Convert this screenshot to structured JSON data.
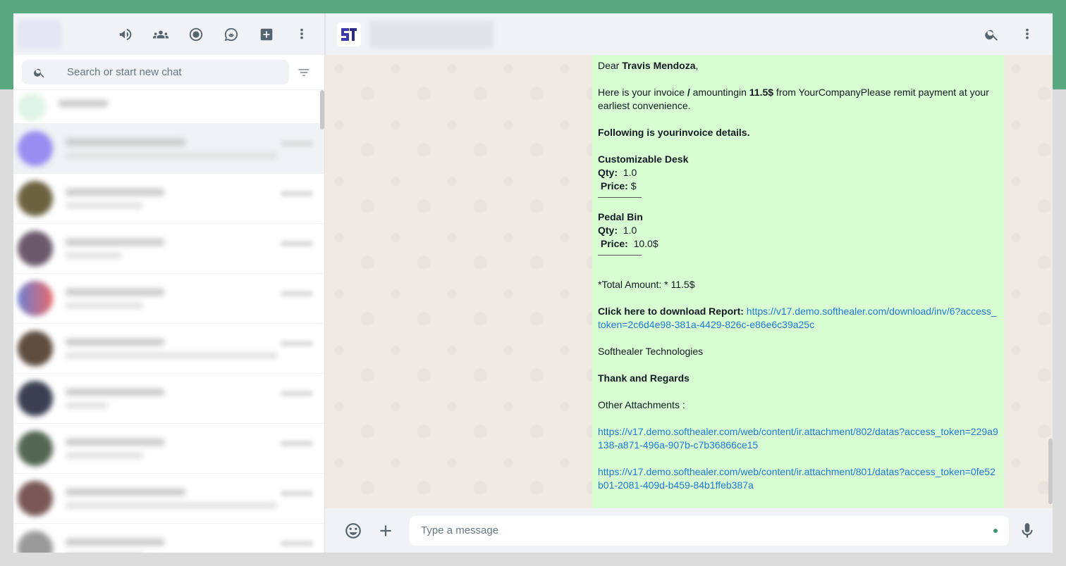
{
  "colors": {
    "brand_band": "#5aa882",
    "bubble_out": "#d9fdd3",
    "link": "#1f7bd0"
  },
  "sidebar": {
    "header_icons": [
      "megaphone-icon",
      "communities-icon",
      "status-icon",
      "channels-icon",
      "new-chat-icon",
      "menu-icon"
    ],
    "search": {
      "placeholder": "Search or start new chat"
    }
  },
  "conversation": {
    "header_icons": [
      "search-icon",
      "menu-icon"
    ],
    "message": {
      "greeting_prefix": "Dear ",
      "customer_name": "Travis Mendoza",
      "greeting_suffix": ",",
      "intro_1": "Here is your invoice ",
      "intro_slash": "/",
      "intro_2": " amountingin ",
      "amount": "11.5$",
      "intro_3": " from YourCompanyPlease remit payment at your earliest convenience.",
      "details_heading": "Following is yourinvoice details.",
      "items": [
        {
          "name": "Customizable Desk",
          "qty_label": "Qty:",
          "qty": "1.0",
          "price_label": "Price:",
          "price": "$"
        },
        {
          "name": "Pedal Bin",
          "qty_label": "Qty:",
          "qty": "1.0",
          "price_label": "Price:",
          "price": "10.0$"
        }
      ],
      "total": " *Total Amount: * 11.5$",
      "download_label": "Click here to download Report:",
      "download_link": "https://v17.demo.softhealer.com/download/inv/6?access_token=2c6d4e98-381a-4429-826c-e86e6c39a25c",
      "company": " Softhealer Technologies",
      "regards": "Thank and Regards",
      "attachments_label": " Other Attachments :",
      "attachment_links": [
        "https://v17.demo.softhealer.com/web/content/ir.attachment/802/datas?access_token=229a9138-a871-496a-907b-c7b36866ce15",
        "https://v17.demo.softhealer.com/web/content/ir.attachment/801/datas?access_token=0fe52b01-2081-409d-b459-84b1ffeb387a"
      ]
    },
    "composer": {
      "placeholder": "Type a message"
    }
  }
}
